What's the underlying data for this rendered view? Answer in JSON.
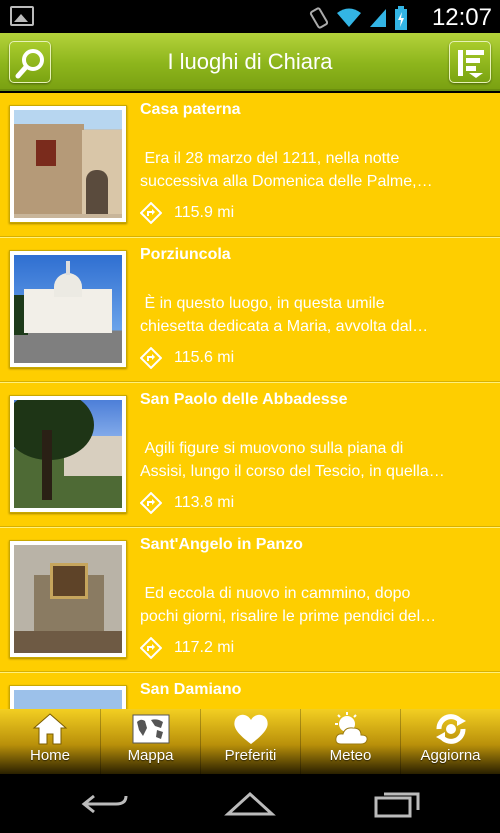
{
  "status_bar": {
    "time": "12:07"
  },
  "header": {
    "title": "I luoghi di Chiara"
  },
  "places": [
    {
      "name": "Casa paterna",
      "excerpt": " Era il 28 marzo del 1211, nella notte\nsuccessiva alla Domenica delle Palme,…",
      "distance": "115.9 mi"
    },
    {
      "name": "Porziuncola",
      "excerpt": " È in questo luogo, in questa umile\nchiesetta dedicata a Maria, avvolta dal…",
      "distance": "115.6 mi"
    },
    {
      "name": "San Paolo delle Abbadesse",
      "excerpt": " Agili figure si muovono sulla piana di\nAssisi, lungo il corso del Tescio, in quella…",
      "distance": "113.8 mi"
    },
    {
      "name": "Sant'Angelo in Panzo",
      "excerpt": " Ed eccola di nuovo in cammino, dopo\npochi giorni, risalire le prime pendici del…",
      "distance": "117.2 mi"
    },
    {
      "name": "San Damiano",
      "excerpt": "",
      "distance": ""
    }
  ],
  "tabs": [
    {
      "label": "Home",
      "icon": "home-icon"
    },
    {
      "label": "Mappa",
      "icon": "map-icon"
    },
    {
      "label": "Preferiti",
      "icon": "heart-icon"
    },
    {
      "label": "Meteo",
      "icon": "weather-icon"
    },
    {
      "label": "Aggiorna",
      "icon": "refresh-icon"
    }
  ],
  "colors": {
    "list_bg": "#fece00",
    "header_green": "#8db51c",
    "text": "#ffffff"
  }
}
